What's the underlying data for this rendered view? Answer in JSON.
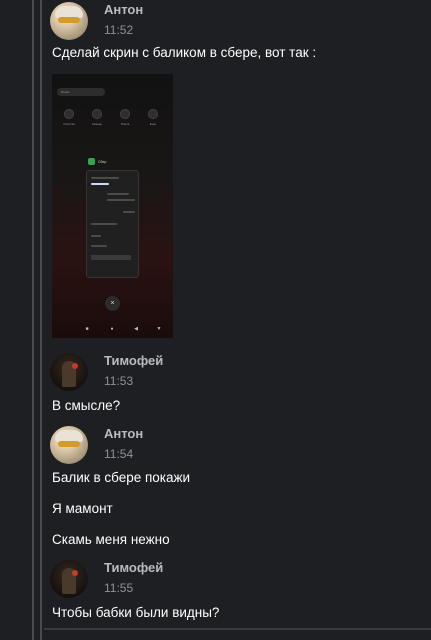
{
  "messages": [
    {
      "author": "Антон",
      "time": "11:52",
      "avatar": "anton",
      "lines": [
        "Сделай скрин с баликом в сбере, вот так :"
      ]
    },
    {
      "author": "Тимофей",
      "time": "11:53",
      "avatar": "tim",
      "lines": [
        "В смысле?"
      ]
    },
    {
      "author": "Антон",
      "time": "11:54",
      "avatar": "anton",
      "lines": [
        "Балик в сбере покажи",
        "Я мамонт",
        "Скамь меня нежно"
      ]
    },
    {
      "author": "Тимофей",
      "time": "11:55",
      "avatar": "tim",
      "lines": [
        "Чтобы бабки были видны?"
      ]
    }
  ],
  "screenshot": {
    "pill_text": "Поиск",
    "quick_actions": [
      "Очистка",
      "Сканер",
      "Поиск",
      "Ещё"
    ],
    "app_label": "Сбер",
    "close_icon": "×",
    "nav_icons": [
      "■",
      "●",
      "◀",
      "▼"
    ]
  },
  "colors": {
    "background": "#1e1f22",
    "author": "#b9bbbe",
    "timestamp": "#8e9297",
    "text": "#ffffff"
  }
}
